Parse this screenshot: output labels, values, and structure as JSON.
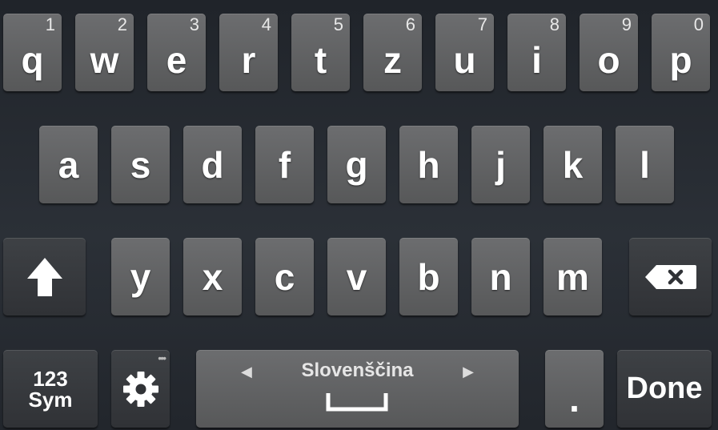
{
  "keyboard": {
    "row1": [
      {
        "label": "q",
        "hint": "1"
      },
      {
        "label": "w",
        "hint": "2"
      },
      {
        "label": "e",
        "hint": "3"
      },
      {
        "label": "r",
        "hint": "4"
      },
      {
        "label": "t",
        "hint": "5"
      },
      {
        "label": "z",
        "hint": "6"
      },
      {
        "label": "u",
        "hint": "7"
      },
      {
        "label": "i",
        "hint": "8"
      },
      {
        "label": "o",
        "hint": "9"
      },
      {
        "label": "p",
        "hint": "0"
      }
    ],
    "row2": [
      "a",
      "s",
      "d",
      "f",
      "g",
      "h",
      "j",
      "k",
      "l"
    ],
    "row3": [
      "y",
      "x",
      "c",
      "v",
      "b",
      "n",
      "m"
    ],
    "bottom": {
      "sym_line1": "123",
      "sym_line2": "Sym",
      "space_language": "Slovenščina",
      "period": ".",
      "done": "Done"
    },
    "icons": {
      "shift": "shift-arrow-icon",
      "backspace": "backspace-icon",
      "settings": "gear-icon",
      "more": "more-dots-icon",
      "space": "space-bar-icon",
      "lang_prev": "triangle-left-icon",
      "lang_next": "triangle-right-icon"
    }
  }
}
